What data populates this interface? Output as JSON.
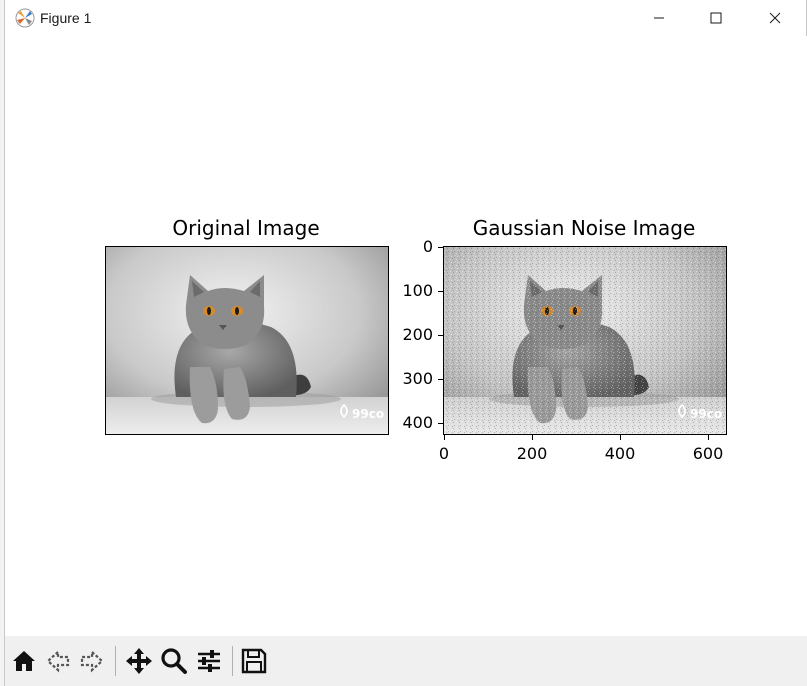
{
  "window": {
    "title": "Figure 1"
  },
  "figure": {
    "left_axes": {
      "title": "Original Image"
    },
    "right_axes": {
      "title": "Gaussian Noise Image",
      "yticks": [
        "0",
        "100",
        "200",
        "300",
        "400"
      ],
      "xticks": [
        "0",
        "200",
        "400",
        "600"
      ]
    },
    "watermark": "99co"
  },
  "toolbar": {
    "tools": [
      "home-icon",
      "back-icon",
      "forward-icon",
      "pan-icon",
      "zoom-icon",
      "configure-subplots-icon",
      "save-icon"
    ]
  },
  "colors": {
    "toolbar_bg": "#f0f0f0",
    "canvas_bg": "#ffffff"
  }
}
